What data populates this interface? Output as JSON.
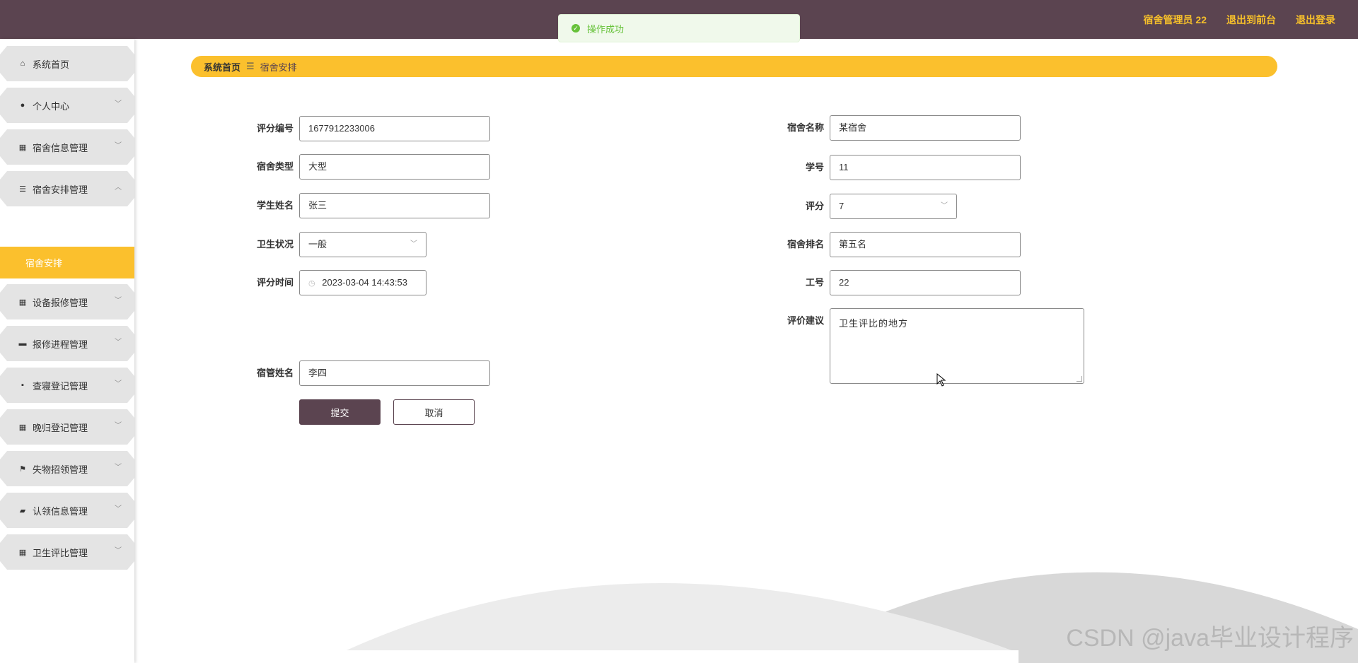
{
  "header": {
    "user_label": "宿舍管理员 22",
    "frontend_link": "退出到前台",
    "logout_link": "退出登录"
  },
  "toast": {
    "message": "操作成功"
  },
  "sidebar": {
    "items": [
      {
        "label": "系统首页",
        "icon": "home-icon"
      },
      {
        "label": "个人中心",
        "icon": "user-icon"
      },
      {
        "label": "宿舍信息管理",
        "icon": "grid-icon"
      },
      {
        "label": "宿舍安排管理",
        "icon": "list-icon"
      },
      {
        "label": "设备报修管理",
        "icon": "grid-icon"
      },
      {
        "label": "报修进程管理",
        "icon": "monitor-icon"
      },
      {
        "label": "查寝登记管理",
        "icon": "chat-icon"
      },
      {
        "label": "晚归登记管理",
        "icon": "grid-icon"
      },
      {
        "label": "失物招领管理",
        "icon": "flag-icon"
      },
      {
        "label": "认领信息管理",
        "icon": "ticket-icon"
      },
      {
        "label": "卫生评比管理",
        "icon": "grid-icon"
      }
    ],
    "active_subitem": "宿舍安排"
  },
  "breadcrumb": {
    "home": "系统首页",
    "separator": "☰",
    "current": "宿舍安排"
  },
  "form": {
    "score_no": {
      "label": "评分编号",
      "value": "1677912233006"
    },
    "dorm_type": {
      "label": "宿舍类型",
      "value": "大型"
    },
    "student_name": {
      "label": "学生姓名",
      "value": "张三"
    },
    "hygiene": {
      "label": "卫生状况",
      "value": "一般"
    },
    "score_time": {
      "label": "评分时间",
      "value": "2023-03-04 14:43:53"
    },
    "manager_name": {
      "label": "宿管姓名",
      "value": "李四"
    },
    "dorm_name": {
      "label": "宿舍名称",
      "value": "某宿舍"
    },
    "student_no": {
      "label": "学号",
      "value": "11"
    },
    "score": {
      "label": "评分",
      "value": "7"
    },
    "dorm_rank": {
      "label": "宿舍排名",
      "value": "第五名"
    },
    "staff_no": {
      "label": "工号",
      "value": "22"
    },
    "suggestion": {
      "label": "评价建议",
      "value": "卫生评比的地方"
    },
    "submit_label": "提交",
    "cancel_label": "取消"
  },
  "watermark": "CSDN @java毕业设计程序",
  "colors": {
    "header": "#5b4450",
    "accent": "#fbc02d",
    "success": "#67c23a"
  }
}
